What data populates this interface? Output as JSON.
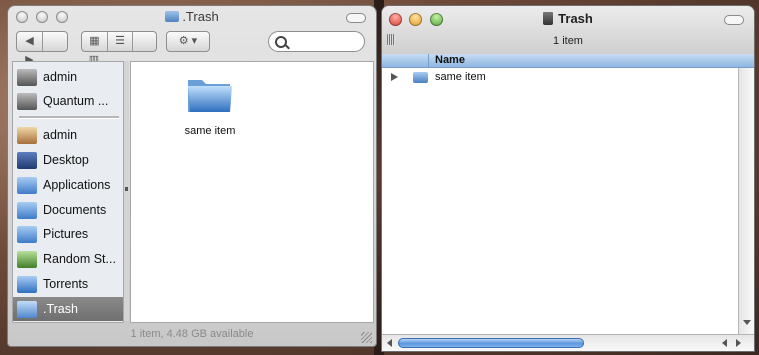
{
  "left_window": {
    "title": ".Trash",
    "sidebar": [
      {
        "label": "admin",
        "icon": "laptop-icon",
        "color": "#6a6a6a"
      },
      {
        "label": "Quantum ...",
        "icon": "laptop-icon",
        "color": "#6a6a6a"
      },
      {
        "label": "admin",
        "icon": "home-icon",
        "color": "#b6874c"
      },
      {
        "label": "Desktop",
        "icon": "desktop-icon",
        "color": "#2f4f8f"
      },
      {
        "label": "Applications",
        "icon": "applications-folder-icon",
        "color": "#4b88d6"
      },
      {
        "label": "Documents",
        "icon": "documents-folder-icon",
        "color": "#4b88d6"
      },
      {
        "label": "Pictures",
        "icon": "pictures-folder-icon",
        "color": "#4b88d6"
      },
      {
        "label": "Random St...",
        "icon": "random-folder-icon",
        "color": "#5a9a3a"
      },
      {
        "label": "Torrents",
        "icon": "torrents-folder-icon",
        "color": "#3a7fd0"
      },
      {
        "label": ".Trash",
        "icon": "trash-folder-icon",
        "color": "#4b88d6"
      }
    ],
    "item_label": "same item",
    "status": "1 item, 4.48 GB available"
  },
  "right_window": {
    "title": "Trash",
    "count": "1 item",
    "column_header": "Name",
    "rows": [
      {
        "label": "same item"
      }
    ],
    "colors": {
      "close": "#e0463d",
      "minimize": "#e8a22a",
      "zoom": "#5cae3a",
      "header_blue": "#a9c9ee"
    }
  }
}
